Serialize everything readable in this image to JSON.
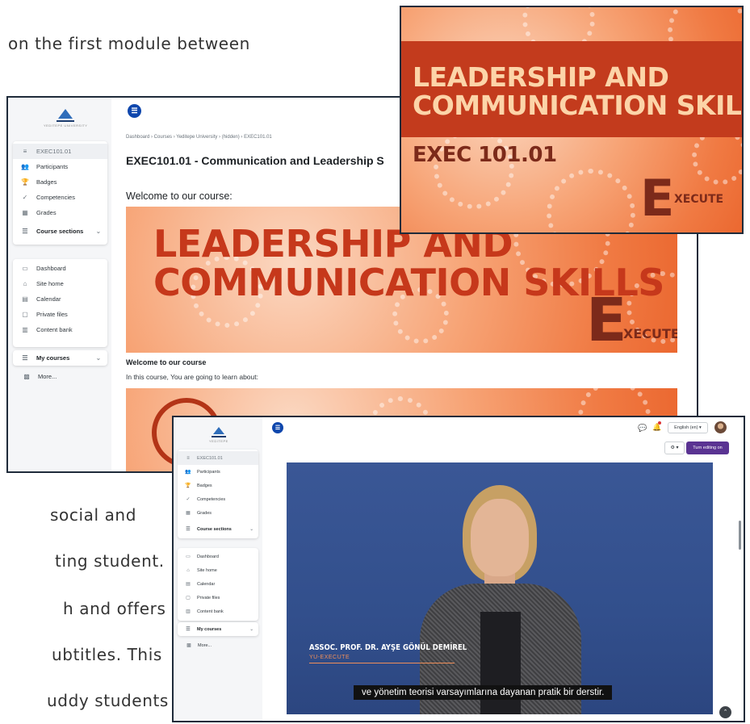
{
  "doc": {
    "lines": [
      "on  the  first  module  between",
      "social    and",
      "ting  student.",
      "h  and  offers",
      "ubtitles.  This",
      "uddy  students"
    ]
  },
  "nav": {
    "course": "EXEC101.01",
    "participants": "Participants",
    "badges": "Badges",
    "competencies": "Competencies",
    "grades": "Grades",
    "course_sections": "Course sections",
    "dashboard": "Dashboard",
    "site_home": "Site home",
    "calendar": "Calendar",
    "private_files": "Private files",
    "content_bank": "Content bank",
    "my_courses": "My courses",
    "more": "More..."
  },
  "shot1": {
    "breadcrumb": "Dashboard  ›  Courses  ›  Yeditepe University  ›  (hidden)  ›  EXEC101.01",
    "course_title": "EXEC101.01 - Communication and Leadership S",
    "welcome": "Welcome to our course:",
    "banner_line1": "LEADERSHIP AND",
    "banner_line2": "COMMUNICATION SKILLS",
    "exec_e": "E",
    "exec_rest": "XECUTE",
    "welcome_heading": "Welcome to our course",
    "welcome_text": "In this course, You are going to learn about:"
  },
  "thumb": {
    "title_line1": "LEADERSHIP AND",
    "title_line2": "COMMUNICATION SKILLS",
    "code": "EXEC 101.01",
    "exec_e": "E",
    "exec_rest": "XECUTE"
  },
  "shot2": {
    "language": "English (en) ▾",
    "turn_editing": "Turn editing on",
    "speaker_name": "ASSOC. PROF. DR. AYŞE GÖNÜL DEMİREL",
    "speaker_org": "YU-EXECUTE",
    "subtitle": "ve yönetim teorisi varsayımlarına dayanan pratik bir derstir."
  },
  "colors": {
    "accent": "#0f47ad",
    "orange": "#f07a43",
    "banner_red": "#c33b1d",
    "execute_brown": "#7c2a1a",
    "edit_button": "#5a3392"
  }
}
